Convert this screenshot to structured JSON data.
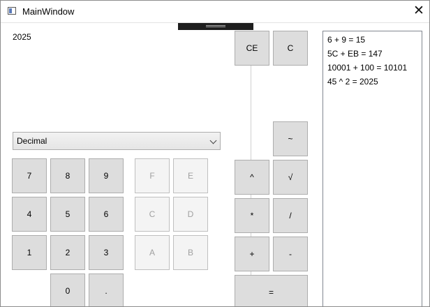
{
  "window": {
    "title": "MainWindow"
  },
  "display": {
    "value": "2025"
  },
  "mode_select": {
    "selected": "Decimal"
  },
  "keys": {
    "ce": "CE",
    "c": "C",
    "tilde": "~",
    "power": "^",
    "sqrt": "√",
    "multiply": "*",
    "divide": "/",
    "plus": "+",
    "minus": "-",
    "equals": "=",
    "d7": "7",
    "d8": "8",
    "d9": "9",
    "d4": "4",
    "d5": "5",
    "d6": "6",
    "d1": "1",
    "d2": "2",
    "d3": "3",
    "d0": "0",
    "dot": ".",
    "hF": "F",
    "hE": "E",
    "hC": "C",
    "hD": "D",
    "hA": "A",
    "hB": "B"
  },
  "history": [
    "6 + 9 = 15",
    "5C + EB = 147",
    "10001 + 100 = 10101",
    "45 ^ 2 = 2025"
  ]
}
